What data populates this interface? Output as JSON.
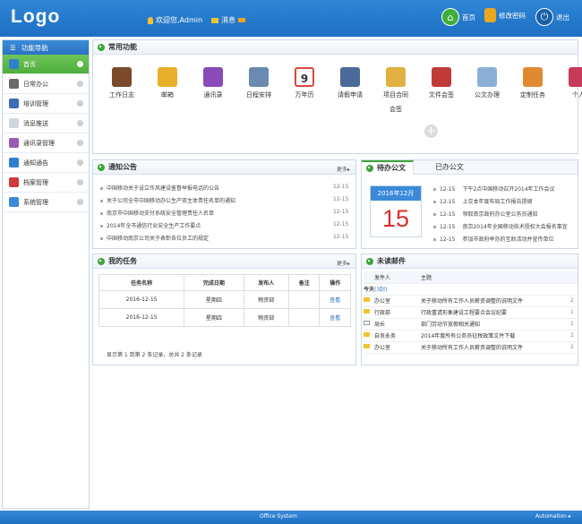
{
  "header": {
    "logo": "Logo",
    "welcome": "欢迎您,Admin",
    "message": "消息",
    "home": "首页",
    "change_pwd": "修改密码",
    "logout": "退出"
  },
  "sidebar": {
    "title": "功能导航",
    "items": [
      {
        "label": "首页",
        "icon": "monitor-icon",
        "color": "#2f7fd0"
      },
      {
        "label": "日常办公",
        "icon": "printer-icon",
        "color": "#6a6a6a"
      },
      {
        "label": "培训管理",
        "icon": "book-icon",
        "color": "#3a6db5"
      },
      {
        "label": "消息推送",
        "icon": "mail-icon",
        "color": "#d0d6de"
      },
      {
        "label": "通讯录管理",
        "icon": "books-icon",
        "color": "#9a5ab8"
      },
      {
        "label": "通知通告",
        "icon": "news-icon",
        "color": "#2f7fd0"
      },
      {
        "label": "档案管理",
        "icon": "archive-icon",
        "color": "#d03a3a"
      },
      {
        "label": "系统管理",
        "icon": "settings-icon",
        "color": "#3a8ad8"
      }
    ]
  },
  "common": {
    "title": "常用功能",
    "items": [
      {
        "label": "工作日志",
        "color": "#7a4a2a"
      },
      {
        "label": "邮箱",
        "color": "#e8b02a"
      },
      {
        "label": "通讯录",
        "color": "#8a4ab8"
      },
      {
        "label": "日程安排",
        "color": "#6a8ab0"
      },
      {
        "label": "万年历",
        "color": "#d84a3a",
        "num": "9"
      },
      {
        "label": "请假申请",
        "color": "#4a6a9a"
      },
      {
        "label": "项目合同",
        "label2": "会签",
        "color": "#e0b040"
      },
      {
        "label": "文件会签",
        "color": "#c03a3a"
      },
      {
        "label": "公文办理",
        "color": "#8ab0d8"
      },
      {
        "label": "定制任务",
        "color": "#e08a30"
      },
      {
        "label": "个人",
        "color": "#c83a5a"
      }
    ]
  },
  "notice": {
    "title": "通知公告",
    "more": "更多",
    "items": [
      {
        "text": "中国移动关于设立作风建设鉴督举报电话的公告",
        "date": "12-15"
      },
      {
        "text": "关于公司全市中国移动办公生产双主体责任名单的通知",
        "date": "12-15"
      },
      {
        "text": "南京市中国移动支付系统安全管理责任人名单",
        "date": "12-15"
      },
      {
        "text": "2014年全市通信行业安全生产工作要点",
        "date": "12-15"
      },
      {
        "text": "中国移动南京公司关于表彰各位员工的规定",
        "date": "12-15"
      }
    ]
  },
  "todo": {
    "tab_active": "待办公文",
    "tab_other": "已办公文",
    "cal_month": "2016年12月",
    "cal_day": "15",
    "items": [
      {
        "date": "12-15",
        "text": "下午2点中国移动召开2014年工作会议"
      },
      {
        "date": "12-15",
        "text": "上交本年度布局工作报告提纲"
      },
      {
        "date": "12-15",
        "text": "领取南京政府办公室公务员通知"
      },
      {
        "date": "12-15",
        "text": "南京2014年全国移动技术授权大会报名事宜"
      },
      {
        "date": "12-15",
        "text": "参加市政府举办的互助活动并宣传单位"
      }
    ]
  },
  "tasks": {
    "title": "我的任务",
    "more": "更多",
    "headers": [
      "任务名称",
      "完成日期",
      "发布人",
      "备注",
      "操作"
    ],
    "rows": [
      {
        "name": "2016-12-15",
        "date": "星期四",
        "publisher": "物资部",
        "note": "",
        "action": "查看"
      },
      {
        "name": "2016-12-15",
        "date": "星期四",
        "publisher": "物资部",
        "note": "",
        "action": "查看"
      }
    ],
    "summary": "显示第 1 到第 2 条记录，总共 2 条记录"
  },
  "mail": {
    "title": "未读邮件",
    "headers": [
      "发件人",
      "主题"
    ],
    "today": "今天",
    "today_count": "(3封)",
    "items": [
      {
        "from": "办公室",
        "subject": "关于移动所有工作人员薪资调整的说明文件",
        "extra": "2",
        "open": false
      },
      {
        "from": "行政部",
        "subject": "行政重请形象建设工程要点会议纪要",
        "extra": "1",
        "open": false
      },
      {
        "from": "局长",
        "subject": "部门劳动节放假相关通知",
        "extra": "1",
        "open": true
      },
      {
        "from": "自贡永务",
        "subject": "2014年度所有公务员征税政策文件下载",
        "extra": "2",
        "open": false
      },
      {
        "from": "办公室",
        "subject": "关于移动所有工作人员薪资调整的说明文件",
        "extra": "2",
        "open": false
      }
    ]
  },
  "footer": {
    "center": "Office System",
    "right": "Automation"
  }
}
